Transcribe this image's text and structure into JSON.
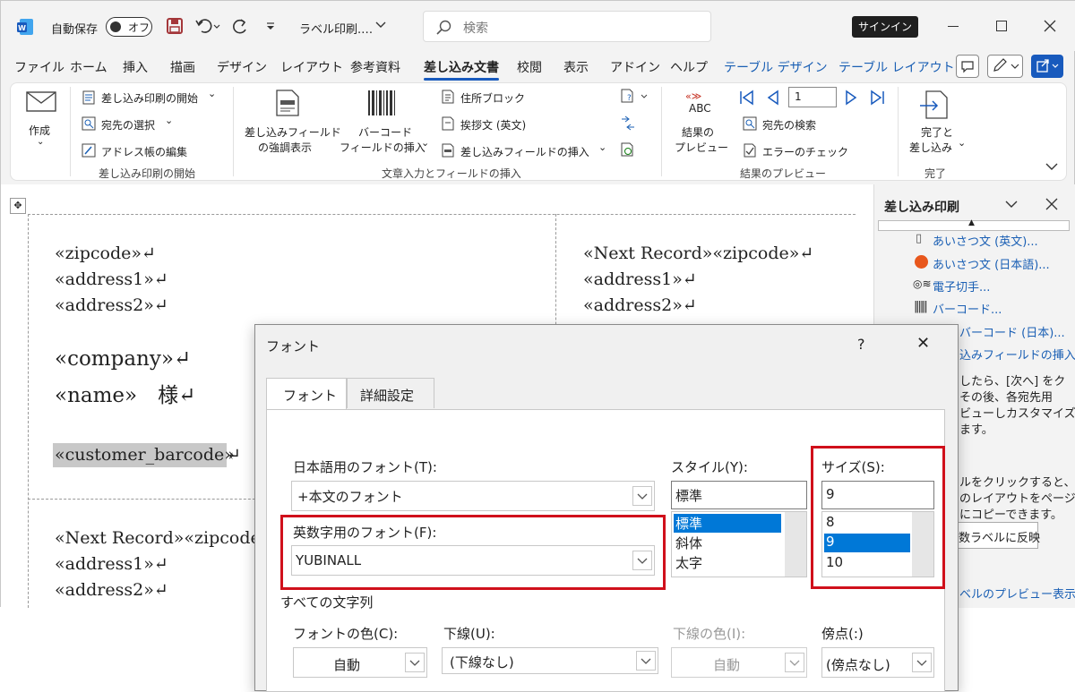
{
  "titlebar": {
    "autosave": "自動保存",
    "toggle": "オフ",
    "doc_title": "ラベル印刷.…",
    "search_placeholder": "検索",
    "signin": "サインイン"
  },
  "tabs": [
    "ファイル",
    "ホーム",
    "挿入",
    "描画",
    "デザイン",
    "レイアウト",
    "参考資料",
    "差し込み文書",
    "校閲",
    "表示",
    "アドイン",
    "ヘルプ",
    "テーブル デザイン",
    "テーブル レイアウト"
  ],
  "ribbon": {
    "create": "作成",
    "start_merge": "差し込み印刷の開始",
    "select_recipients": "宛先の選択",
    "edit_list": "アドレス帳の編集",
    "group1": "差し込み印刷の開始",
    "highlight_line1": "差し込みフィールド",
    "highlight_line2": "の強調表示",
    "barcode_line1": "バーコード",
    "barcode_line2": "フィールドの挿入",
    "address_block": "住所ブロック",
    "greeting": "挨拶文 (英文)",
    "insert_field": "差し込みフィールドの挿入",
    "group2": "文章入力とフィールドの挿入",
    "abc": "ABC",
    "preview_line1": "結果の",
    "preview_line2": "プレビュー",
    "record_no": "1",
    "find_recipient": "宛先の検索",
    "check_errors": "エラーのチェック",
    "group3": "結果のプレビュー",
    "finish_line1": "完了と",
    "finish_line2": "差し込み",
    "group4": "完了"
  },
  "document": {
    "left": {
      "zip": "«zipcode»↵",
      "addr1": "«address1»↵",
      "addr2": "«address2»↵",
      "company": "«company»↵",
      "name": "«name»　様↵",
      "barcode": "«customer_barcode»",
      "barcode_mark": "↵"
    },
    "right": {
      "zip": "«Next Record»«zipcode»↵",
      "addr1": "«address1»↵",
      "addr2": "«address2»↵"
    },
    "bottom": {
      "zip": "«Next Record»«zipcode»",
      "addr1": "«address1»↵",
      "addr2": "«address2»↵"
    }
  },
  "pane": {
    "title": "差し込み印刷",
    "items": [
      "あいさつ文 (英文)...",
      "あいさつ文 (日本語)...",
      "電子切手...",
      "バーコード...",
      "バーコード (日本)...",
      "込みフィールドの挿入..."
    ],
    "text1": [
      "したら、[次へ] をク",
      "その後、各宛先用",
      "ビューしカスタマイズ",
      "ます。"
    ],
    "text2": [
      "ルをクリックすると、最初",
      "のレイアウトをページの別",
      "にコピーできます。"
    ],
    "button": "数ラベルに反映",
    "footer": "ベルのプレビュー表示"
  },
  "dialog": {
    "title": "フォント",
    "help": "?",
    "close": "✕",
    "tabs": [
      "フォント",
      "詳細設定"
    ],
    "jp_font_label": "日本語用のフォント(T):",
    "jp_font_value": "+本文のフォント",
    "en_font_label": "英数字用のフォント(F):",
    "en_font_value": "YUBINALL",
    "style_label": "スタイル(Y):",
    "style_value": "標準",
    "style_options": [
      "標準",
      "斜体",
      "太字"
    ],
    "size_label": "サイズ(S):",
    "size_value": "9",
    "size_options": [
      "8",
      "9",
      "10"
    ],
    "all_text": "すべての文字列",
    "color_label": "フォントの色(C):",
    "color_value": "自動",
    "underline_label": "下線(U):",
    "underline_value": "(下線なし)",
    "ucolor_label": "下線の色(I):",
    "ucolor_value": "自動",
    "emphasis_label": "傍点(:)",
    "emphasis_value": "(傍点なし)"
  },
  "colors": {
    "accent": "#185abd",
    "red_highlight": "#d0101b",
    "selection": "#0078d7"
  }
}
